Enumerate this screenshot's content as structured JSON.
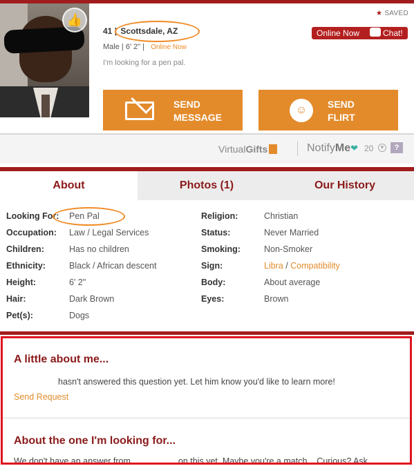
{
  "header": {
    "age": "41",
    "city": "Scottsdale, AZ",
    "gender": "Male",
    "height": "6' 2\"",
    "online_status": "Online Now",
    "tagline": "I'm looking for a pen pal.",
    "saved_label": "SAVED",
    "online_now_label": "Online Now",
    "chat_label": "Chat!"
  },
  "actions": {
    "send_message_line1": "SEND",
    "send_message_line2": "MESSAGE",
    "send_flirt_line1": "SEND",
    "send_flirt_line2": "FLIRT"
  },
  "gift_bar": {
    "virtual": "Virtual",
    "gifts": "Gifts",
    "notify": "Notify",
    "me": "Me",
    "notify_count": "20",
    "help": "?"
  },
  "tabs": [
    {
      "label": "About"
    },
    {
      "label": "Photos (1)"
    },
    {
      "label": "Our History"
    }
  ],
  "details": {
    "left": [
      {
        "key": "Looking For:",
        "value": "Pen Pal"
      },
      {
        "key": "Occupation:",
        "value": "Law / Legal Services"
      },
      {
        "key": "Children:",
        "value": "Has no children"
      },
      {
        "key": "Ethnicity:",
        "value": "Black / African descent"
      },
      {
        "key": "Height:",
        "value": "6' 2\""
      },
      {
        "key": "Hair:",
        "value": "Dark Brown"
      },
      {
        "key": "Pet(s):",
        "value": "Dogs"
      }
    ],
    "right": [
      {
        "key": "Religion:",
        "value": "Christian"
      },
      {
        "key": "Status:",
        "value": "Never Married"
      },
      {
        "key": "Smoking:",
        "value": "Non-Smoker"
      },
      {
        "key": "Sign:",
        "value": "Libra",
        "extra": "Compatibility"
      },
      {
        "key": "Body:",
        "value": "About average"
      },
      {
        "key": "Eyes:",
        "value": "Brown"
      }
    ]
  },
  "about_me": {
    "heading": "A little about me...",
    "text": "hasn't answered this question yet. Let him know you'd like to learn more!",
    "request_label": "Send Request"
  },
  "looking_for": {
    "heading": "About the one I'm looking for...",
    "text_start": "We don't have an answer from",
    "text_end": "on this yet. Maybe you're a match... Curious? Ask"
  },
  "colors": {
    "brand_red": "#a11c1c",
    "accent_orange": "#e38b2b",
    "highlight_oval": "#f08a24",
    "box_border": "#e0131f"
  }
}
